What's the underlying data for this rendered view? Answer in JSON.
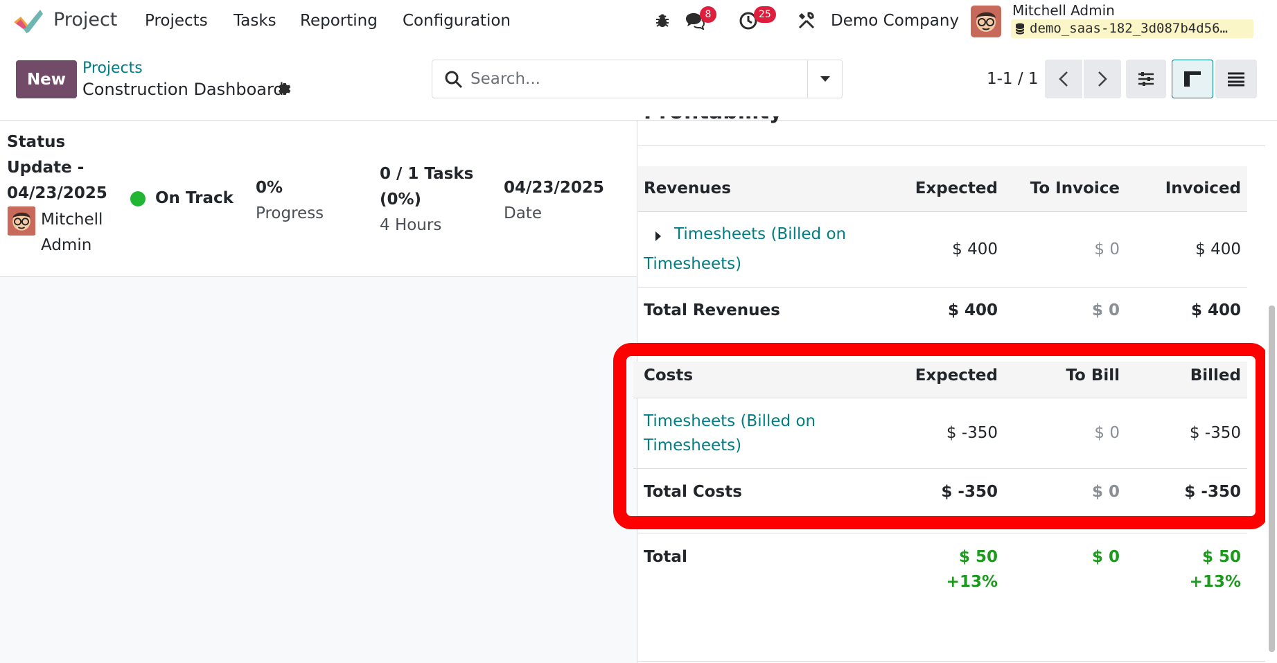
{
  "navbar": {
    "app_name": "Project",
    "menu": [
      "Projects",
      "Tasks",
      "Reporting",
      "Configuration"
    ],
    "chat_badge": "8",
    "activity_badge": "25",
    "company": "Demo Company",
    "user_name": "Mitchell Admin",
    "database": "demo_saas-182_3d087b4d56…"
  },
  "control_panel": {
    "new_label": "New",
    "breadcrumb_parent": "Projects",
    "record_title": "Construction Dashboard",
    "search_placeholder": "Search...",
    "pager": "1-1 / 1"
  },
  "status_update": {
    "title_line1": "Status",
    "title_line2": "Update -",
    "title_line3": "04/23/2025",
    "author_line1": "Mitchell",
    "author_line2": "Admin",
    "status": "On Track",
    "progress_value": "0%",
    "progress_label": "Progress",
    "tasks_line1": "0 / 1 Tasks",
    "tasks_line2": "(0%)",
    "hours": "4 Hours",
    "date_value": "04/23/2025",
    "date_label": "Date"
  },
  "profitability": {
    "title": "Profitability",
    "revenues": {
      "headers": [
        "Revenues",
        "Expected",
        "To Invoice",
        "Invoiced"
      ],
      "row_line1": "Timesheets (Billed on",
      "row_line2": "Timesheets)",
      "row_expected": "$ 400",
      "row_to_invoice": "$ 0",
      "row_invoiced": "$ 400",
      "total_label": "Total Revenues",
      "total_expected": "$ 400",
      "total_to_invoice": "$ 0",
      "total_invoiced": "$ 400"
    },
    "costs": {
      "headers": [
        "Costs",
        "Expected",
        "To Bill",
        "Billed"
      ],
      "row_line1": "Timesheets (Billed on",
      "row_line2": "Timesheets)",
      "row_expected": "$ -350",
      "row_to_bill": "$ 0",
      "row_billed": "$ -350",
      "total_label": "Total Costs",
      "total_expected": "$ -350",
      "total_to_bill": "$ 0",
      "total_billed": "$ -350"
    },
    "total": {
      "label": "Total",
      "expected": "$ 50",
      "expected_pct": "+13%",
      "to_bill": "$ 0",
      "billed": "$ 50",
      "billed_pct": "+13%"
    }
  }
}
